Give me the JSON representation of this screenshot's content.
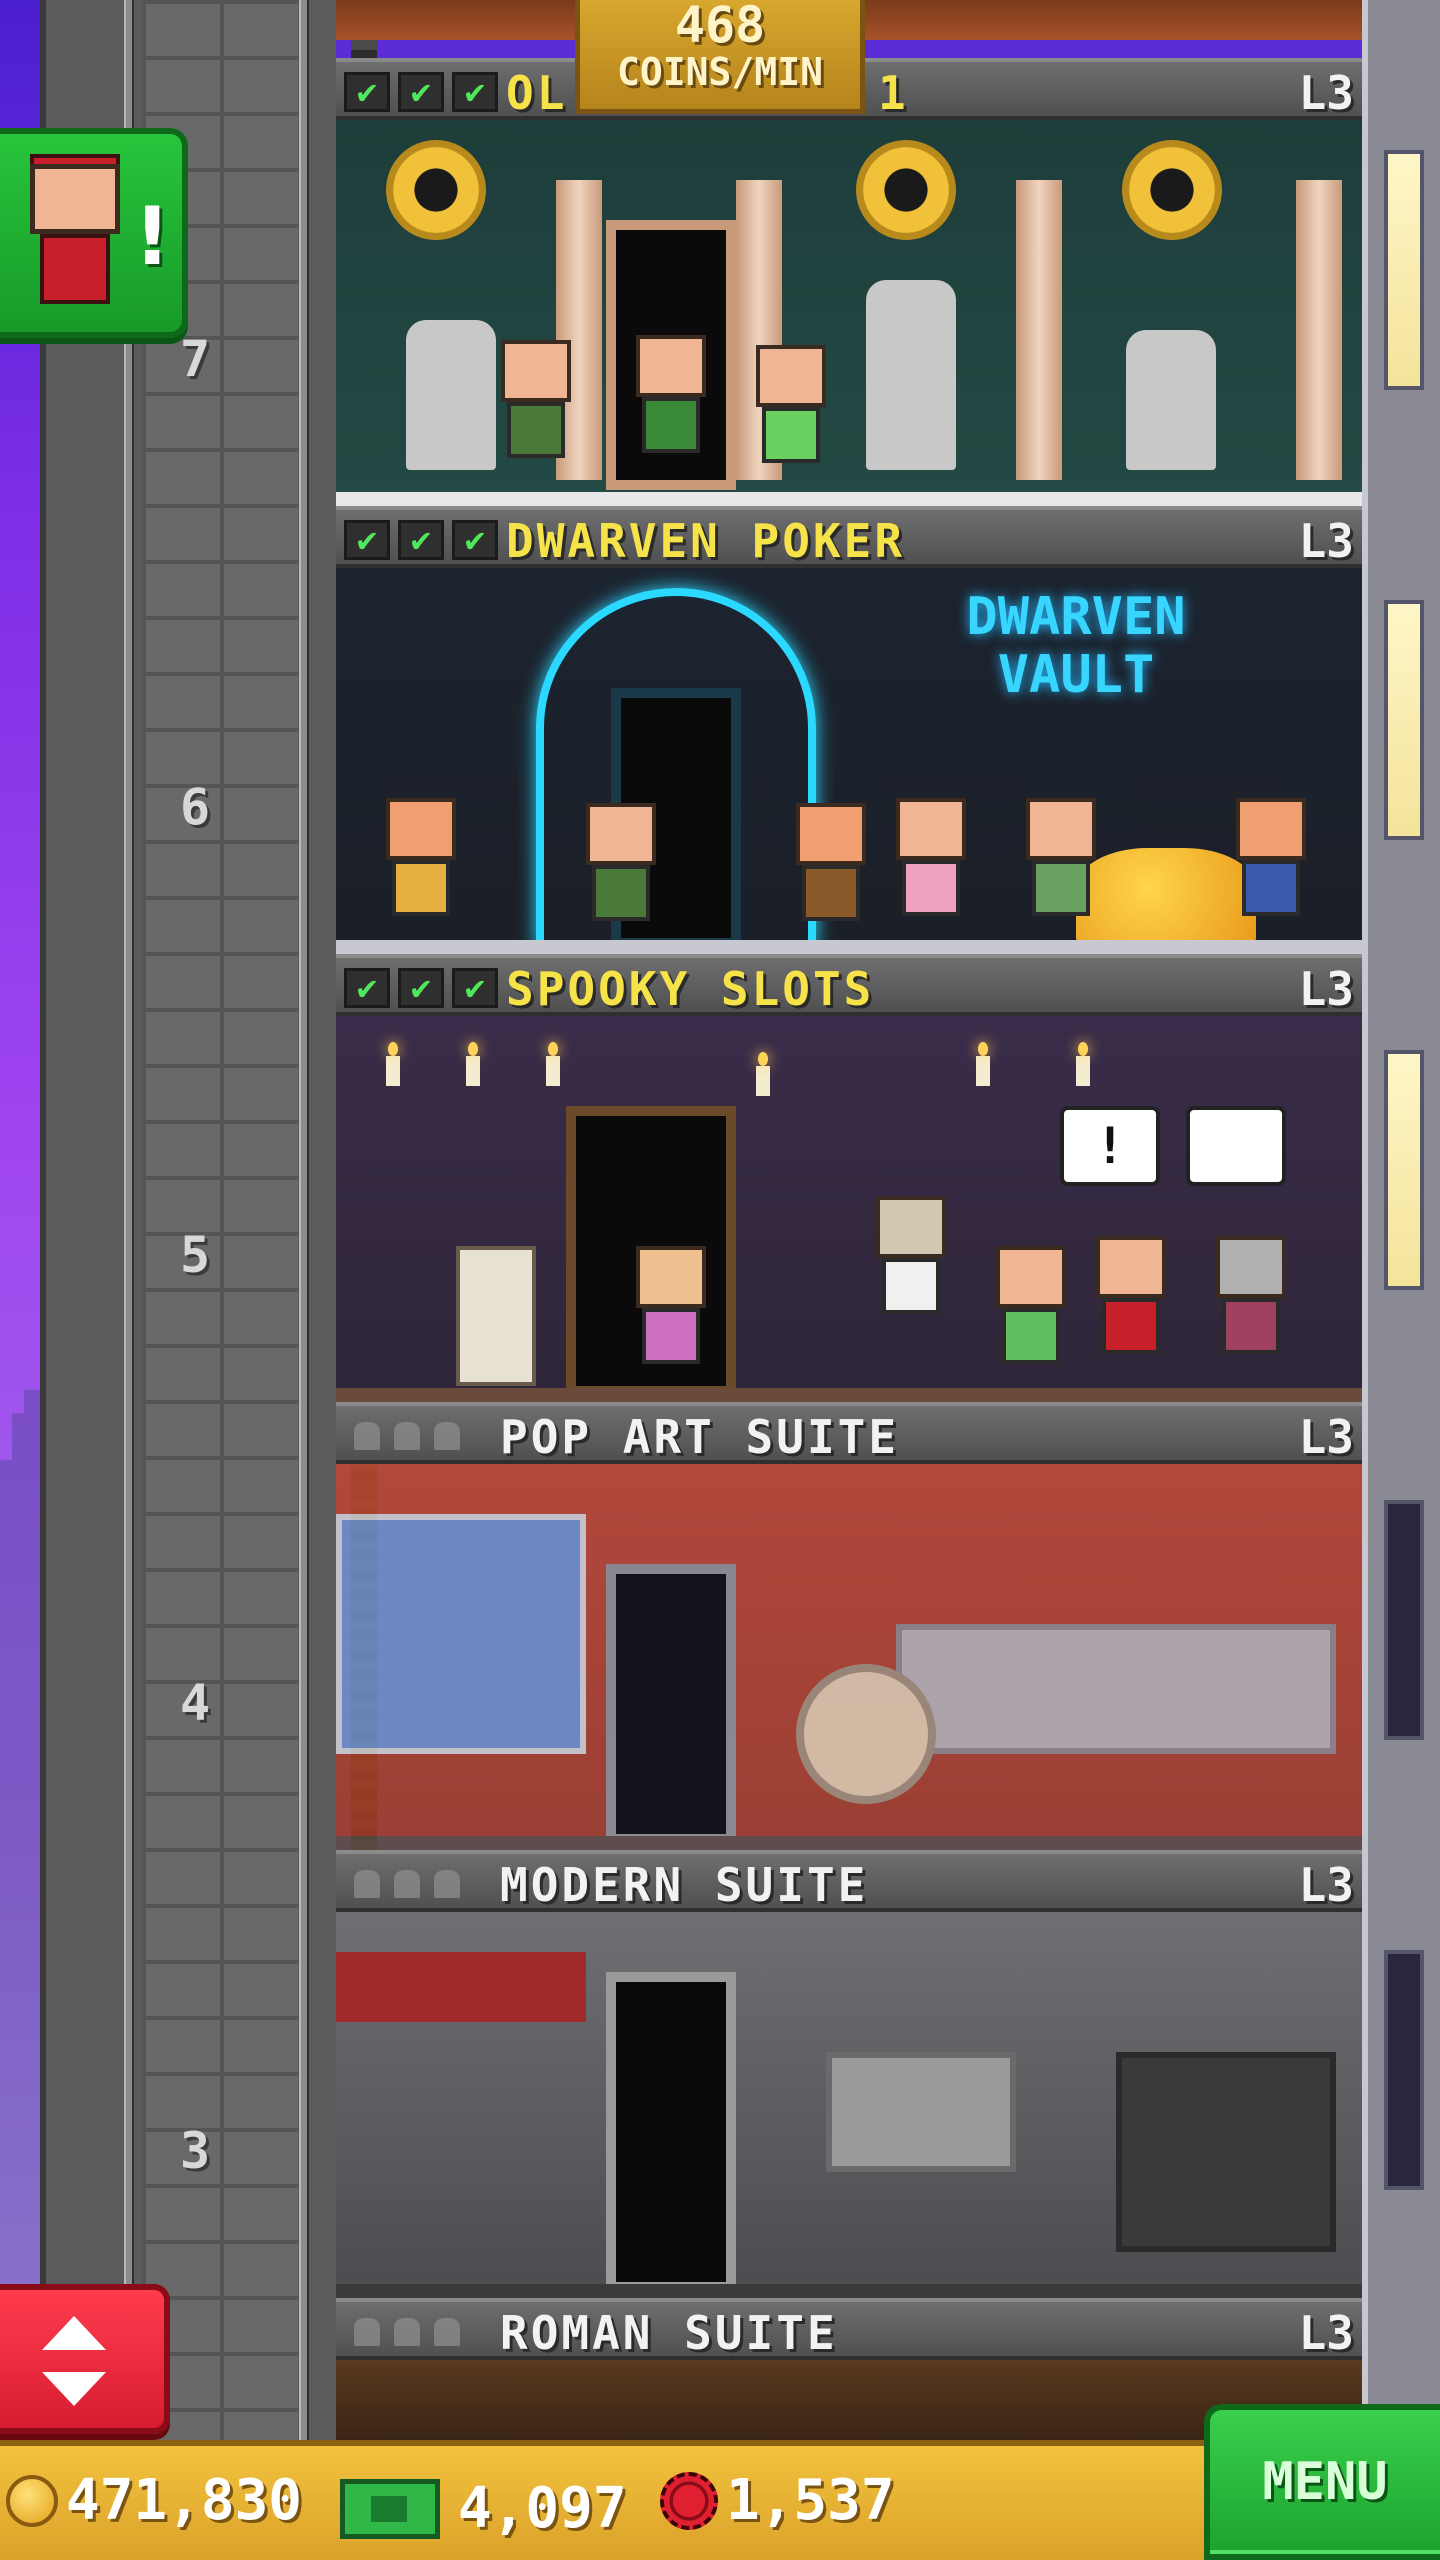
{
  "coins_per_min": {
    "value": "468",
    "unit": "COINS/MIN"
  },
  "floors": [
    {
      "number": "7",
      "name": "OL",
      "name_suffix": "1",
      "level": "L3",
      "stocked": true,
      "checks": 3
    },
    {
      "number": "6",
      "name": "DWARVEN POKER",
      "level": "L3",
      "stocked": true,
      "checks": 3,
      "sign": [
        "DWARVEN",
        "VAULT"
      ]
    },
    {
      "number": "5",
      "name": "SPOOKY SLOTS",
      "level": "L3",
      "stocked": true,
      "checks": 3
    },
    {
      "number": "4",
      "name": "POP ART SUITE",
      "level": "L3",
      "stocked": false
    },
    {
      "number": "3",
      "name": "MODERN SUITE",
      "level": "L3",
      "stocked": false
    },
    {
      "number": "",
      "name": "ROMAN SUITE",
      "level": "L3",
      "stocked": false
    }
  ],
  "check_glyph": "✔",
  "bellhop": {
    "alert": "!"
  },
  "currency": {
    "coins": "471,830",
    "bux": "4,097",
    "chips": "1,537"
  },
  "menu_label": "MENU",
  "colors": {
    "gold_title": "#f6e34a",
    "menu_green": "#1ba22e",
    "elevator_red": "#d81c30",
    "neon_blue": "#2bd8ff"
  },
  "icons": [
    "check-icon",
    "coin-icon",
    "bux-icon",
    "chip-icon",
    "elevator-arrows-icon",
    "bellhop-icon"
  ]
}
